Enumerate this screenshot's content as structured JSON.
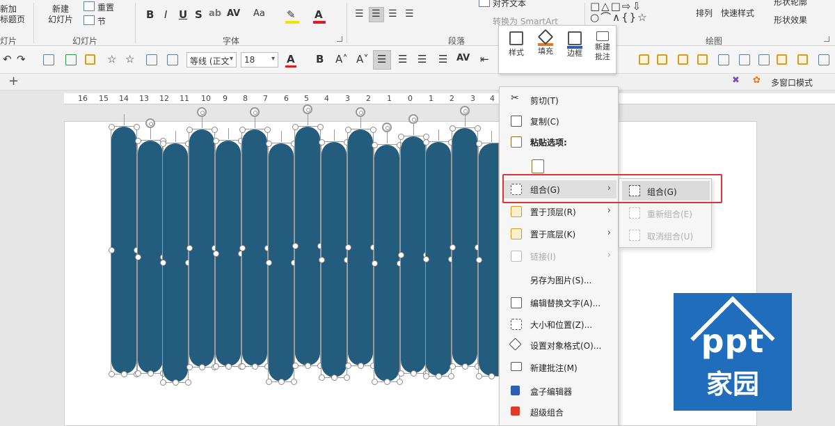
{
  "ribbon": {
    "slides": {
      "new_label": "新建\n幻灯片",
      "reset_label": "重置",
      "section_label": "节",
      "group_label": "幻灯片",
      "left_partial": "新加\n标题页",
      "left_group_partial": "灯片"
    },
    "font": {
      "group_label": "字体",
      "bold": "B",
      "italic": "I",
      "underline": "U",
      "strike": "S",
      "spacing": "AV",
      "case": "Aa",
      "font_color": "A"
    },
    "paragraph": {
      "group_label": "段落",
      "align_text": "对齐文本",
      "smartart": "转换为 SmartArt"
    },
    "drawing": {
      "group_label": "绘图",
      "arrange": "排列",
      "quick_styles": "快速样式",
      "shape_outline": "形状轮廓",
      "shape_effects": "形状效果"
    }
  },
  "qat": {
    "font_name": "等线 (正文",
    "font_size": "18",
    "bold": "B"
  },
  "tabs": {
    "multi_window": "多窗口模式"
  },
  "ruler": {
    "ticks": [
      "16",
      "15",
      "14",
      "13",
      "12",
      "11",
      "10",
      "9",
      "8",
      "7",
      "6",
      "5",
      "4",
      "3",
      "2",
      "1",
      "0",
      "1",
      "2",
      "3",
      "4"
    ]
  },
  "mini_toolbar": {
    "style": "样式",
    "fill": "填充",
    "border": "边框",
    "new_comment": "新建\n批注"
  },
  "context_menu": {
    "items": [
      {
        "label": "剪切(T)",
        "icon": "scissors-icon"
      },
      {
        "label": "复制(C)",
        "icon": "copy-icon"
      },
      {
        "label": "粘贴选项:",
        "icon": "paste-icon"
      },
      {
        "label": "组合(G)",
        "icon": "group-icon"
      },
      {
        "label": "置于顶层(R)",
        "icon": "bring-front-icon"
      },
      {
        "label": "置于底层(K)",
        "icon": "send-back-icon"
      },
      {
        "label": "链接(I)",
        "icon": "link-icon"
      },
      {
        "label": "另存为图片(S)...",
        "icon": ""
      },
      {
        "label": "编辑替换文字(A)...",
        "icon": "alt-text-icon"
      },
      {
        "label": "大小和位置(Z)...",
        "icon": "size-position-icon"
      },
      {
        "label": "设置对象格式(O)...",
        "icon": "format-object-icon"
      },
      {
        "label": "新建批注(M)",
        "icon": "comment-icon"
      },
      {
        "label": "盒子编辑器",
        "icon": "box-editor-icon"
      },
      {
        "label": "超级组合",
        "icon": "super-group-icon"
      }
    ]
  },
  "submenu": {
    "items": [
      "组合(G)",
      "重新组合(E)",
      "取消组合(U)"
    ]
  },
  "logo": {
    "line1": "ppt",
    "line2": "家园"
  },
  "colors": {
    "shape_fill": "#235c7d",
    "highlight": "#d9343a",
    "logo_bg": "#1f6dbb"
  }
}
